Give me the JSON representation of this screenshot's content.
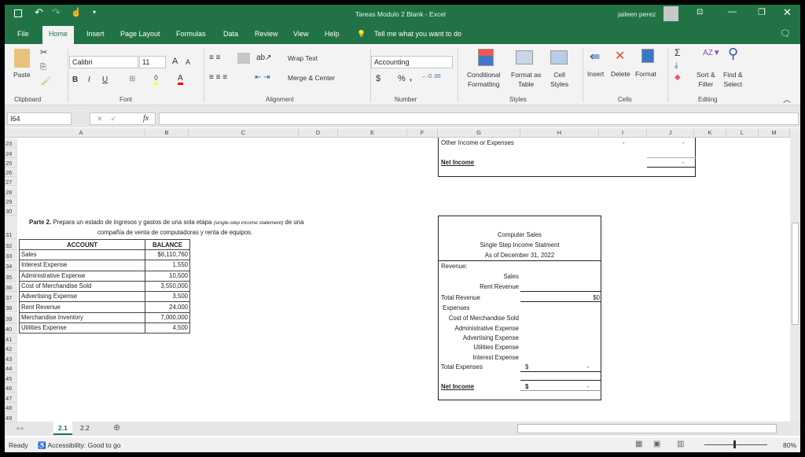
{
  "window": {
    "title": "Tareas Modulo 2 Blank  -  Excel",
    "user": "jaileen perez"
  },
  "tabs": [
    "File",
    "Home",
    "Insert",
    "Page Layout",
    "Formulas",
    "Data",
    "Review",
    "View",
    "Help"
  ],
  "tell_me": "Tell me what you want to do",
  "ribbon": {
    "paste": "Paste",
    "font_name": "Calibri",
    "font_size": "11",
    "wrap_text": "Wrap Text",
    "merge_center": "Merge & Center",
    "number_format": "Accounting",
    "currency": "$",
    "percent": "%",
    "comma": ",",
    "conditional": [
      "Conditional",
      "Formatting"
    ],
    "format_table": [
      "Format as",
      "Table"
    ],
    "cell_styles": [
      "Cell",
      "Styles"
    ],
    "insert": "Insert",
    "delete": "Delete",
    "format": "Format",
    "sort": [
      "Sort &",
      "Filter"
    ],
    "find": [
      "Find &",
      "Select"
    ],
    "groups": {
      "clipboard": "Clipboard",
      "font": "Font",
      "alignment": "Alignment",
      "number": "Number",
      "styles": "Styles",
      "cells": "Cells",
      "editing": "Editing"
    }
  },
  "formula_bar": {
    "name_box": "I64",
    "fx": "fx",
    "value": ""
  },
  "columns": [
    "A",
    "B",
    "C",
    "D",
    "E",
    "F",
    "G",
    "H",
    "I",
    "J",
    "K",
    "L",
    "M"
  ],
  "rows": [
    "23",
    "24",
    "25",
    "26",
    "27",
    "28",
    "29",
    "30",
    "31",
    "32",
    "33",
    "34",
    "35",
    "36",
    "37",
    "38",
    "39",
    "40",
    "41",
    "42",
    "43",
    "44",
    "45",
    "46",
    "47",
    "48",
    "49"
  ],
  "top_box": {
    "other_income": "Other Income or Expenses",
    "dash_i": "-",
    "dash_j": "-",
    "net_income": "Net Income",
    "net_value": "-"
  },
  "instructions": {
    "line1_a": "Parte 2.",
    "line1_b": " Prepara un estado de ingresos y gastos de una sola etapa ",
    "line1_italic": "(single-step income statement)",
    "line1_c": " de una",
    "line2": "compañía de venta de computadoras y renta de equipos."
  },
  "account_table": {
    "headers": [
      "ACCOUNT",
      "BALANCE"
    ],
    "rows": [
      [
        "Sales",
        "$6,110,760"
      ],
      [
        "Interest Expense",
        "1,550"
      ],
      [
        "Administrative Expense",
        "10,500"
      ],
      [
        "Cost of Merchandise Sold",
        "3,550,000"
      ],
      [
        "Advertising Expense",
        "3,500"
      ],
      [
        "Rent Revenue",
        "24,000"
      ],
      [
        "Merchandise Inventory",
        "7,000,000"
      ],
      [
        "Utilities Expense",
        "4,500"
      ]
    ]
  },
  "statement": {
    "company": "Computer Sales",
    "title": "Single Step Income Statment",
    "date": "As of December 31, 2022",
    "revenue": "Revenue:",
    "sales": "Sales",
    "rent_revenue": "Rent Revenue",
    "total_revenue": "Total Revenue",
    "total_revenue_value": "$0",
    "expenses": "Expenses",
    "cogs": "Cost of Merchandise Sold",
    "admin": "Administrative Expense",
    "advertising": "Advertising Expense",
    "utilities": "Utilities Expense",
    "interest": "Interest Expense",
    "total_expenses": "Total Expenses",
    "te_currency": "$",
    "te_value": "-",
    "net_income": "Net Income",
    "ni_currency": "$",
    "ni_value": "-"
  },
  "sheets": [
    "2.1",
    "2.2"
  ],
  "active_sheet": "2.1",
  "status": {
    "ready": "Ready",
    "accessibility": "Accessibility: Good to go",
    "zoom": "80%"
  },
  "colors": {
    "excel_green": "#217346",
    "ribbon_bg": "#f3f3f3"
  }
}
